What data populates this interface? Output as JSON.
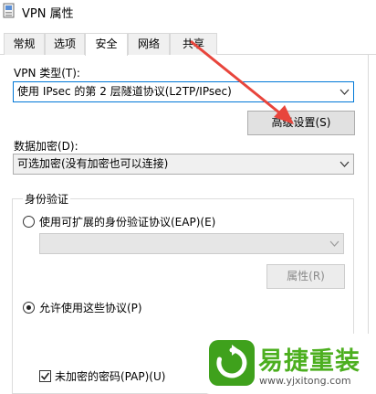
{
  "window": {
    "title": "VPN 属性",
    "icon": "network-connection-icon"
  },
  "tabs": [
    {
      "label": "常规",
      "active": false
    },
    {
      "label": "选项",
      "active": false
    },
    {
      "label": "安全",
      "active": true
    },
    {
      "label": "网络",
      "active": false
    },
    {
      "label": "共享",
      "active": false
    }
  ],
  "security": {
    "vpn_type_label": "VPN 类型(T):",
    "vpn_type_value": "使用 IPsec 的第 2 层隧道协议(L2TP/IPsec)",
    "advanced_button": "高级设置(S)",
    "encryption_label": "数据加密(D):",
    "encryption_value": "可选加密(没有加密也可以连接)",
    "auth_group_title": "身份验证",
    "eap_radio_label": "使用可扩展的身份验证协议(EAP)(E)",
    "eap_value": "",
    "properties_button": "属性(R)",
    "allow_protocols_label": "允许使用这些协议(P)",
    "pap_label": "未加密的密码(PAP)(U)"
  },
  "watermark": {
    "name": "易捷重装",
    "url": "www.yjxitong.com"
  },
  "colors": {
    "accent": "#0078d7",
    "arrow": "#e8453c",
    "watermark_green": "#4caf1f"
  }
}
